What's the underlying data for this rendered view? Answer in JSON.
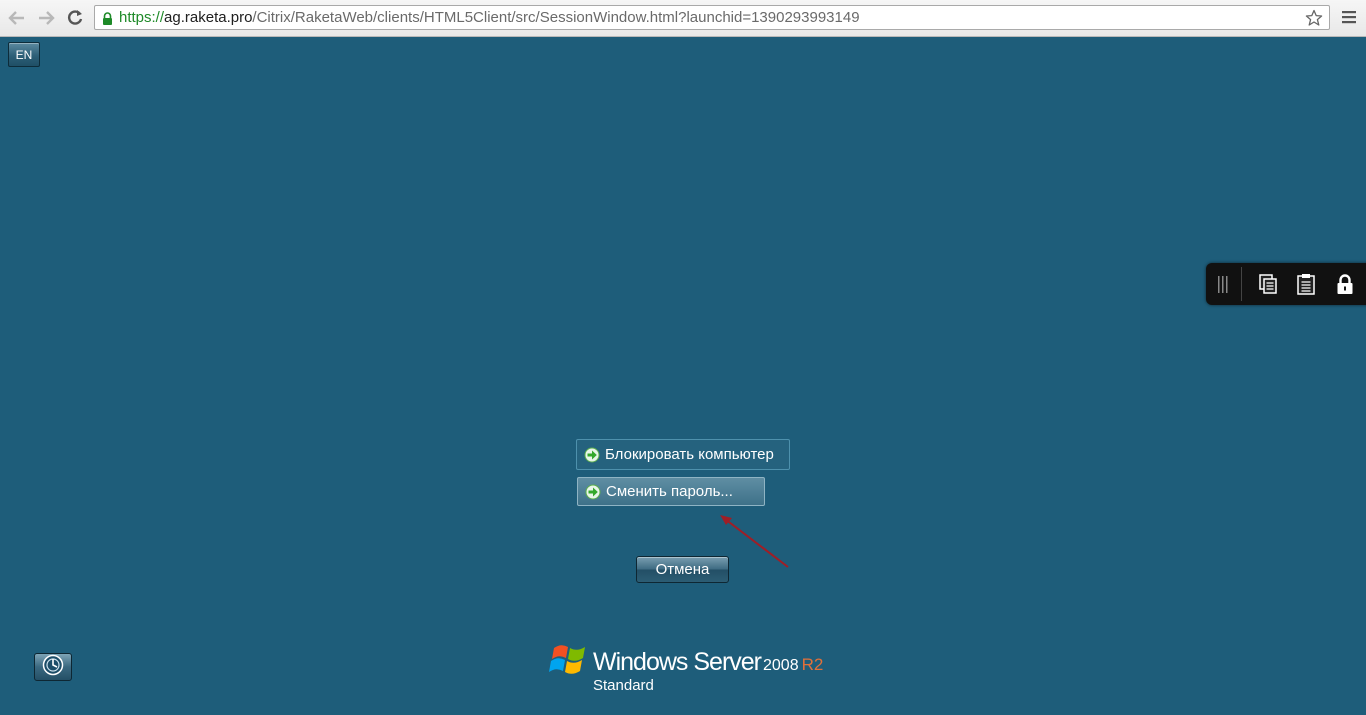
{
  "browser": {
    "url_scheme": "https://",
    "url_host": "ag.raketa.pro",
    "url_path": "/Citrix/RaketaWeb/clients/HTML5Client/src/SessionWindow.html?launchid=1390293993149",
    "icons": {
      "back": "back-arrow-icon",
      "forward": "forward-arrow-icon",
      "reload": "reload-icon",
      "lock": "padlock-icon",
      "bookmark": "star-icon",
      "menu": "hamburger-menu-icon"
    }
  },
  "session": {
    "language_label": "EN",
    "toolbar_icons": [
      "grip-icon",
      "copy-icon",
      "paste-icon",
      "lock-icon"
    ]
  },
  "security_screen": {
    "options": [
      {
        "label": "Блокировать компьютер",
        "icon": "green-arrow-icon"
      },
      {
        "label": "Сменить пароль...",
        "icon": "green-arrow-icon"
      }
    ],
    "cancel_label": "Отмена",
    "annotation_color": "#a01e26"
  },
  "branding": {
    "product": "Windows Server",
    "version": "2008",
    "release": "R2",
    "edition": "Standard"
  },
  "colors": {
    "desktop_background": "#1e5d7a",
    "release_accent": "#e0703a",
    "url_secure_green": "#1e8a28"
  }
}
